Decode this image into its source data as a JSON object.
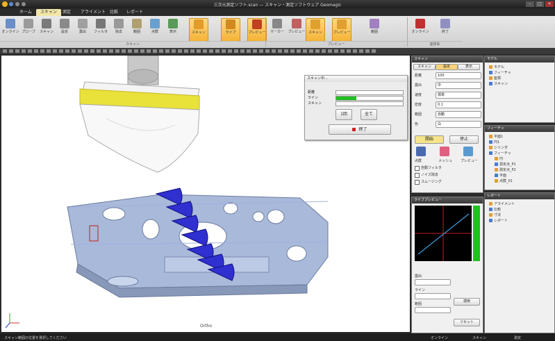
{
  "app": {
    "title": "三次元測定ソフト.scan — スキャン・測定ソフトウェア Geomagic",
    "tabs": [
      "ホーム",
      "スキャン",
      "測定",
      "アライメント",
      "比較",
      "レポート"
    ],
    "active_tab": 1
  },
  "ribbon": {
    "buttons": [
      {
        "label": "オンライン",
        "color": "#6a8fc8"
      },
      {
        "label": "プローブ",
        "color": "#9a9a9a"
      },
      {
        "label": "スキャン",
        "color": "#7a7a7a"
      },
      {
        "label": "設定",
        "color": "#8a8a8a"
      },
      {
        "label": "露出",
        "color": "#a0a0a0"
      },
      {
        "label": "フィルタ",
        "color": "#777"
      },
      {
        "label": "除去",
        "color": "#999"
      },
      {
        "label": "範囲",
        "color": "#b0a070"
      },
      {
        "label": "点群",
        "color": "#6aa0d0"
      },
      {
        "label": "表示",
        "color": "#5a9a5a"
      },
      {
        "label": "スキャン",
        "color": "#e39b2a",
        "hl": true
      },
      {
        "label": "ライブ",
        "color": "#d08a20",
        "hl": true
      },
      {
        "label": "プレビュー",
        "color": "#c04020",
        "hl": true
      },
      {
        "label": "マーカー",
        "color": "#888"
      },
      {
        "label": "プレビュー",
        "color": "#c06060"
      },
      {
        "label": "スキャン",
        "color": "#e0a030",
        "hl": true
      },
      {
        "label": "プレビュー",
        "color": "#e0a030",
        "hl": true
      },
      {
        "label": "範囲",
        "color": "#a080c0"
      },
      {
        "label": "オンライン",
        "color": "#c03030"
      },
      {
        "label": "終了",
        "color": "#9090c0"
      }
    ],
    "groups": [
      "スキャン",
      "プレビュー",
      "座標系"
    ]
  },
  "dialog": {
    "title": "スキャン中...",
    "rows": [
      "距離",
      "ライン",
      "スキャン"
    ],
    "progress": [
      0.0,
      0.3,
      0.0
    ],
    "btn_pause": "1回",
    "btn_step": "全て",
    "btn_stop": "終了"
  },
  "scan_panel": {
    "title": "スキャン",
    "tabs": [
      "スキャン",
      "設定",
      "表示"
    ],
    "fields": [
      {
        "label": "距離",
        "value": "100"
      },
      {
        "label": "露出",
        "value": "中"
      },
      {
        "label": "速度",
        "value": "標準"
      },
      {
        "label": "密度",
        "value": "0.1"
      },
      {
        "label": "範囲",
        "value": "自動"
      },
      {
        "label": "色",
        "value": "白"
      }
    ],
    "start": "開始",
    "stop": "停止",
    "options": [
      "点群",
      "メッシュ",
      "プレビュー"
    ],
    "checks": [
      "自動フィルタ",
      "ノイズ除去",
      "スムージング"
    ]
  },
  "live_panel": {
    "title": "ライブプレビュー",
    "labels": [
      "露出",
      "ライン",
      "範囲"
    ],
    "buttons": [
      "適用",
      "リセット"
    ]
  },
  "tree_top": {
    "title": "モデル",
    "items": [
      "モデル",
      "フィーチャ",
      "座標",
      "スキャン"
    ]
  },
  "tree_mid": {
    "title": "フィーチャ",
    "items": [
      "平面1",
      "円1",
      "シリンダ",
      "フィーチャ",
      "円",
      "測定点_P1",
      "測定点_P2",
      "平面",
      "点群_01"
    ]
  },
  "tree_bot": {
    "title": "レポート",
    "items": [
      "アライメント",
      "比較",
      "寸法",
      "レポート"
    ]
  },
  "viewport": {
    "label": "Ortho"
  },
  "status": {
    "left": "スキャン範囲の位置を選択してください",
    "right": [
      "オンライン",
      "スキャン",
      "測定"
    ]
  },
  "colors": {
    "accent": "#f0c040",
    "probe_band": "#f0e030",
    "part": "#a8b8d8",
    "markers": "#3030d0",
    "graph_bg": "#000000",
    "graph_bar": "#20c020"
  }
}
